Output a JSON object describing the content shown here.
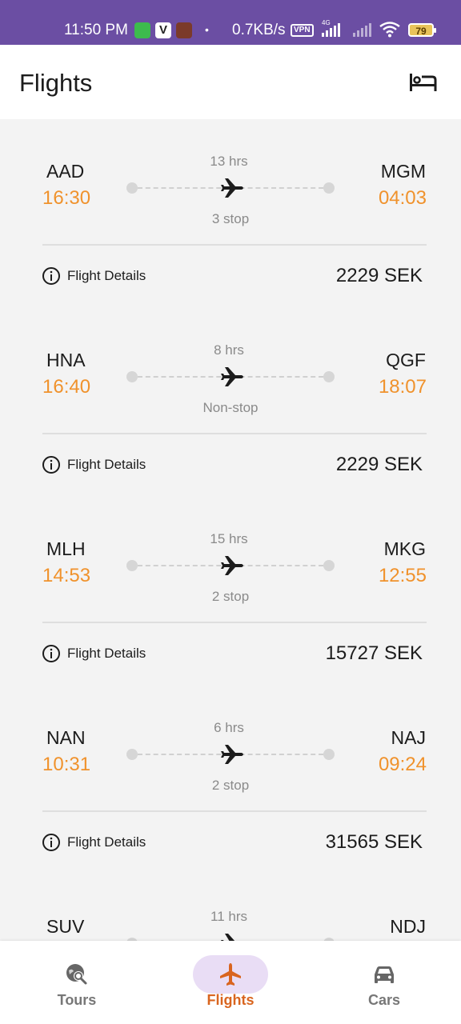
{
  "status_bar": {
    "time": "11:50 PM",
    "speed": "0.7KB/s",
    "vpn": "VPN",
    "network": "4G",
    "battery": "79",
    "app_icon_label": "V"
  },
  "app_bar": {
    "title": "Flights",
    "hotel_icon": "hotel-bed-icon"
  },
  "flights": [
    {
      "from": "AAD",
      "to": "MGM",
      "dep": "16:30",
      "arr": "04:03",
      "duration": "13 hrs",
      "stops": "3 stop",
      "details": "Flight Details",
      "price": "2229 SEK"
    },
    {
      "from": "HNA",
      "to": "QGF",
      "dep": "16:40",
      "arr": "18:07",
      "duration": "8 hrs",
      "stops": "Non-stop",
      "details": "Flight Details",
      "price": "2229 SEK"
    },
    {
      "from": "MLH",
      "to": "MKG",
      "dep": "14:53",
      "arr": "12:55",
      "duration": "15 hrs",
      "stops": "2 stop",
      "details": "Flight Details",
      "price": "15727 SEK"
    },
    {
      "from": "NAN",
      "to": "NAJ",
      "dep": "10:31",
      "arr": "09:24",
      "duration": "6 hrs",
      "stops": "2 stop",
      "details": "Flight Details",
      "price": "31565 SEK"
    },
    {
      "from": "SUV",
      "to": "NDJ",
      "dep": "",
      "arr": "",
      "duration": "11 hrs",
      "stops": "",
      "details": "",
      "price": ""
    }
  ],
  "bottom_nav": {
    "items": [
      {
        "label": "Tours",
        "icon": "tour-search-icon"
      },
      {
        "label": "Flights",
        "icon": "airplane-icon"
      },
      {
        "label": "Cars",
        "icon": "car-icon"
      }
    ],
    "active": "Flights"
  },
  "colors": {
    "status_bar": "#6b4ea3",
    "accent_time": "#f0922c",
    "active_nav": "#d9651f",
    "active_pill": "#e9ddf5"
  }
}
